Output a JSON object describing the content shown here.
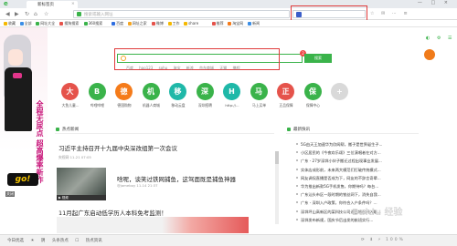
{
  "browser": {
    "tab_title": "新标签页",
    "tab_close": "×",
    "window_controls": "— □ ×",
    "address_placeholder": "搜索或输入网址",
    "nav_right": "☆ ✉ ⋯ ≡"
  },
  "bookmarks": [
    {
      "label": "收藏",
      "color": "#f5b800"
    },
    {
      "label": "全部",
      "color": "#3b8ee6"
    },
    {
      "label": "网址大全",
      "color": "#3ab34a"
    },
    {
      "label": "搜狗搜索",
      "color": "#e5534b"
    },
    {
      "label": "360搜索",
      "color": "#3ab34a"
    },
    {
      "label": "百度",
      "color": "#2d6de0"
    },
    {
      "label": "网址之家",
      "color": "#f5a623"
    },
    {
      "label": "微博",
      "color": "#e5534b"
    },
    {
      "label": "工作",
      "color": "#f5b800"
    },
    {
      "label": "share",
      "color": "#f5b800"
    },
    {
      "label": "推荐",
      "color": "#e5534b"
    },
    {
      "label": "淘宝网",
      "color": "#f57b1a"
    },
    {
      "label": "新闻",
      "color": "#3b8ee6"
    }
  ],
  "ad": {
    "text": "全程无尿点 超高爆率新作",
    "logo": "go!",
    "close_label": "关闭"
  },
  "search": {
    "button_label": "搜索",
    "badge": "2",
    "engines": "百度 hao123 sohu 淘宝 新浪 京东商城 天猫 携程"
  },
  "top_right": "◐ ⚙ ☰",
  "apps": [
    {
      "label": "大鱼儿童...",
      "glyph": "大",
      "color": "#e5534b"
    },
    {
      "label": "哔哩哔哩",
      "glyph": "B",
      "color": "#3ab34a"
    },
    {
      "label": "德国购物",
      "glyph": "德",
      "color": "#f57b1a"
    },
    {
      "label": "机器人商城",
      "glyph": "机",
      "color": "#3ab34a"
    },
    {
      "label": "移动云盘",
      "glyph": "移",
      "color": "#1fb8a8"
    },
    {
      "label": "深圳招聘",
      "glyph": "深",
      "color": "#3ab34a"
    },
    {
      "label": "http://...",
      "glyph": "H",
      "color": "#1fb8a8"
    },
    {
      "label": "马上买单",
      "glyph": "马",
      "color": "#3ab34a"
    },
    {
      "label": "正品保障",
      "glyph": "正",
      "color": "#e5534b"
    },
    {
      "label": "保障中心",
      "glyph": "保",
      "color": "#3ab34a"
    },
    {
      "label": "",
      "glyph": "+",
      "color": "#d9d9d9"
    }
  ],
  "news": {
    "header": "热点新闻",
    "items": [
      {
        "title": "习近平主持召开十九届中央深改组第一次会议",
        "meta": "央视网   11-21 07:05"
      },
      {
        "title": "啥呢，谈笑过铁网捕鱼，这驾面既是捕鱼神器",
        "meta": "@jameboy   11-14 21:37"
      },
      {
        "title": "11月起广东启动低学历人本科免考监测！",
        "meta": ""
      }
    ],
    "video_caption": "▶ 视频"
  },
  "side": {
    "header": "最新快讯",
    "items": [
      "5G由天王加速华为欣闻帮，搬子是世界诞生子...",
      "小区居民的《今夜欢乐颂》三位演唱者在对方...",
      "广东 - 27岁深圳小伙子搬迁过程出现事业发展...",
      "实体店成形前，未来两大模范们打破传统模式...",
      "网友调侃直播是否成为下，网友的不辞言奇辈...",
      "华为推出新款5G手机发售，你期待吗？每台...",
      "广东汕头市区一段时期的铁丝网下，消失自我...",
      "广东 - 深圳入户政策，你符合入户条件吗？...",
      "深圳坪山高新区的某科技公司近日将召开入职...",
      "深圳发布新规，国庆节后出发的航班实行..."
    ]
  },
  "statusbar": {
    "left": "今日优选  ☀ 阴  头条热点  ☐  热点资讯",
    "right": "⟳ ⬇ ⚡ 100%"
  },
  "watermark": "Baidu 经验"
}
